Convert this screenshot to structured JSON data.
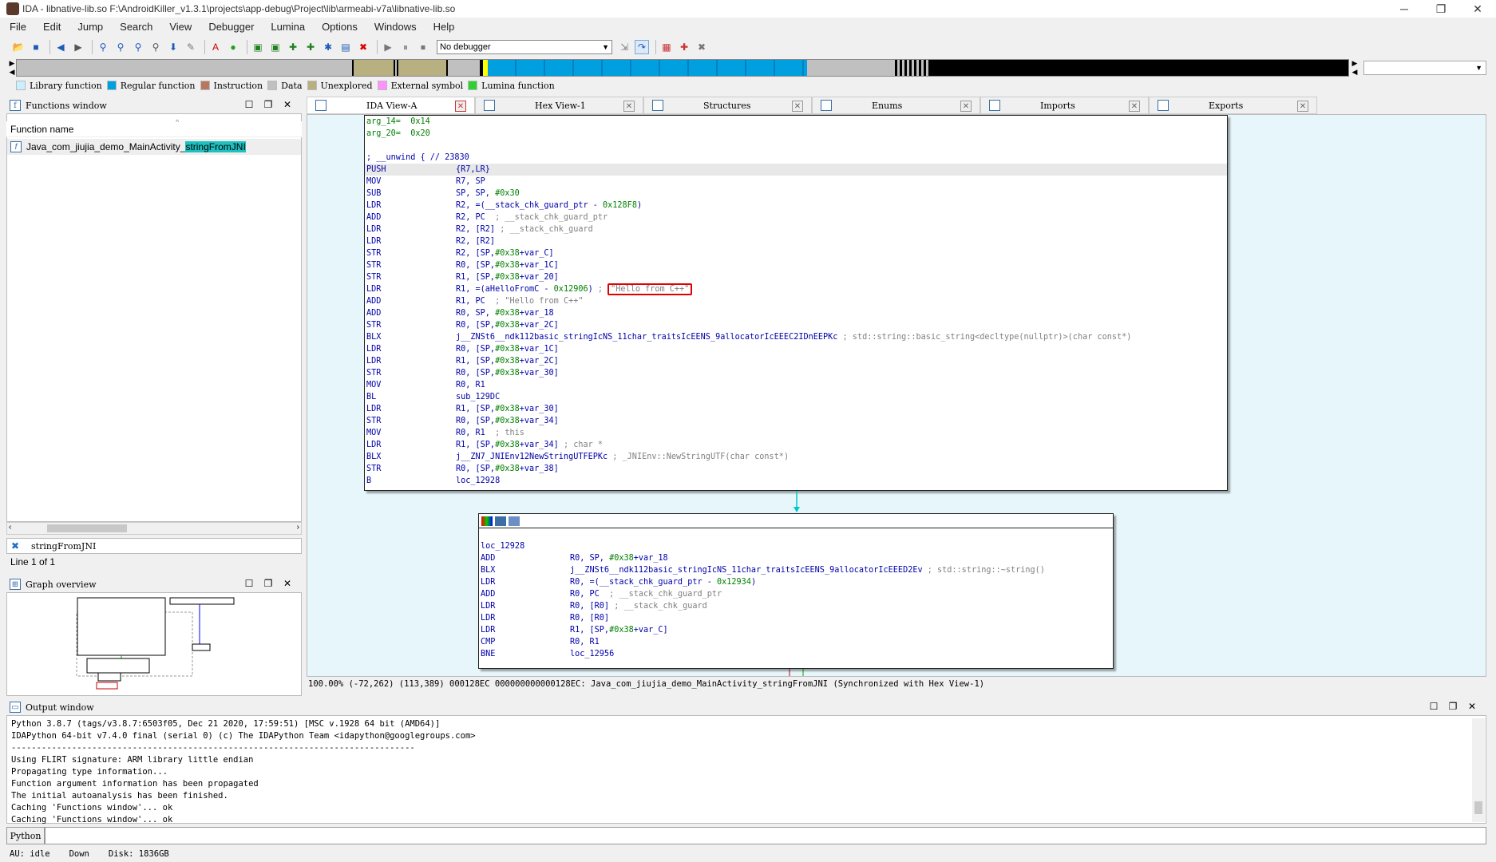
{
  "window": {
    "title": "IDA - libnative-lib.so F:\\AndroidKiller_v1.3.1\\projects\\app-debug\\Project\\lib\\armeabi-v7a\\libnative-lib.so",
    "min": "─",
    "max": "❐",
    "close": "✕"
  },
  "menu": [
    "File",
    "Edit",
    "Jump",
    "Search",
    "View",
    "Debugger",
    "Lumina",
    "Options",
    "Windows",
    "Help"
  ],
  "toolbar": {
    "debugger": "No debugger"
  },
  "legend": [
    {
      "label": "Library function",
      "color": "#c8f0ff"
    },
    {
      "label": "Regular function",
      "color": "#00a0e0"
    },
    {
      "label": "Instruction",
      "color": "#b87860"
    },
    {
      "label": "Data",
      "color": "#c0c0c0"
    },
    {
      "label": "Unexplored",
      "color": "#b8b080"
    },
    {
      "label": "External symbol",
      "color": "#ff90ff"
    },
    {
      "label": "Lumina function",
      "color": "#30d030"
    }
  ],
  "functions_window": {
    "title": "Functions window",
    "column": "Function name",
    "row_prefix": "Java_com_jiujia_demo_MainActivity_",
    "row_highlight": "stringFromJNI",
    "search": "stringFromJNI",
    "line_count": "Line 1 of 1"
  },
  "graph_overview": {
    "title": "Graph overview"
  },
  "tabs": [
    {
      "label": "IDA View-A",
      "active": true
    },
    {
      "label": "Hex View-1",
      "active": false
    },
    {
      "label": "Structures",
      "active": false
    },
    {
      "label": "Enums",
      "active": false
    },
    {
      "label": "Imports",
      "active": false
    },
    {
      "label": "Exports",
      "active": false
    }
  ],
  "node1": {
    "lines": [
      {
        "t": "arg",
        "a": "arg_14=  ",
        "b": "0x14"
      },
      {
        "t": "arg",
        "a": "arg_20=  ",
        "b": "0x20"
      },
      {
        "t": "blank"
      },
      {
        "t": "comment",
        "text": "; __unwind { // 23830"
      },
      {
        "t": "ins",
        "m": "PUSH",
        "o": "{R7,LR}",
        "c": "",
        "sel": true
      },
      {
        "t": "ins",
        "m": "MOV",
        "o": "R7, SP",
        "c": ""
      },
      {
        "t": "ins",
        "m": "SUB",
        "o": "SP, SP, #0x30",
        "c": ""
      },
      {
        "t": "ins",
        "m": "LDR",
        "o": "R2, =(__stack_chk_guard_ptr - 0x128F8)",
        "c": ""
      },
      {
        "t": "ins",
        "m": "ADD",
        "o": "R2, PC",
        "c": "  ; __stack_chk_guard_ptr"
      },
      {
        "t": "ins",
        "m": "LDR",
        "o": "R2, [R2]",
        "c": " ; __stack_chk_guard"
      },
      {
        "t": "ins",
        "m": "LDR",
        "o": "R2, [R2]",
        "c": ""
      },
      {
        "t": "ins",
        "m": "STR",
        "o": "R2, [SP,#0x38+var_C]",
        "c": ""
      },
      {
        "t": "ins",
        "m": "STR",
        "o": "R0, [SP,#0x38+var_1C]",
        "c": ""
      },
      {
        "t": "ins",
        "m": "STR",
        "o": "R1, [SP,#0x38+var_20]",
        "c": ""
      },
      {
        "t": "ins",
        "m": "LDR",
        "o": "R1, =(aHelloFromC - 0x12906)",
        "c": " ; ",
        "box": "\"Hello from C++\""
      },
      {
        "t": "ins",
        "m": "ADD",
        "o": "R1, PC",
        "c": "  ; \"Hello from C++\""
      },
      {
        "t": "ins",
        "m": "ADD",
        "o": "R0, SP, #0x38+var_18",
        "c": ""
      },
      {
        "t": "ins",
        "m": "STR",
        "o": "R0, [SP,#0x38+var_2C]",
        "c": ""
      },
      {
        "t": "ins",
        "m": "BLX",
        "o": "j__ZNSt6__ndk112basic_stringIcNS_11char_traitsIcEENS_9allocatorIcEEEC2IDnEEPKc",
        "c": " ; std::string::basic_string<decltype(nullptr)>(char const*)"
      },
      {
        "t": "ins",
        "m": "LDR",
        "o": "R0, [SP,#0x38+var_1C]",
        "c": ""
      },
      {
        "t": "ins",
        "m": "LDR",
        "o": "R1, [SP,#0x38+var_2C]",
        "c": ""
      },
      {
        "t": "ins",
        "m": "STR",
        "o": "R0, [SP,#0x38+var_30]",
        "c": ""
      },
      {
        "t": "ins",
        "m": "MOV",
        "o": "R0, R1",
        "c": ""
      },
      {
        "t": "ins",
        "m": "BL",
        "o": "sub_129DC",
        "c": ""
      },
      {
        "t": "ins",
        "m": "LDR",
        "o": "R1, [SP,#0x38+var_30]",
        "c": ""
      },
      {
        "t": "ins",
        "m": "STR",
        "o": "R0, [SP,#0x38+var_34]",
        "c": ""
      },
      {
        "t": "ins",
        "m": "MOV",
        "o": "R0, R1",
        "c": "  ; this"
      },
      {
        "t": "ins",
        "m": "LDR",
        "o": "R1, [SP,#0x38+var_34]",
        "c": " ; char *"
      },
      {
        "t": "ins",
        "m": "BLX",
        "o": "j__ZN7_JNIEnv12NewStringUTFEPKc",
        "c": " ; _JNIEnv::NewStringUTF(char const*)"
      },
      {
        "t": "ins",
        "m": "STR",
        "o": "R0, [SP,#0x38+var_38]",
        "c": ""
      },
      {
        "t": "ins",
        "m": "B",
        "o": "loc_12928",
        "c": ""
      }
    ]
  },
  "node2": {
    "lines": [
      {
        "t": "blank"
      },
      {
        "t": "label",
        "text": "loc_12928"
      },
      {
        "t": "ins",
        "m": "ADD",
        "o": "R0, SP, #0x38+var_18",
        "c": ""
      },
      {
        "t": "ins",
        "m": "BLX",
        "o": "j__ZNSt6__ndk112basic_stringIcNS_11char_traitsIcEENS_9allocatorIcEEED2Ev",
        "c": " ; std::string::~string()"
      },
      {
        "t": "ins",
        "m": "LDR",
        "o": "R0, =(__stack_chk_guard_ptr - 0x12934)",
        "c": ""
      },
      {
        "t": "ins",
        "m": "ADD",
        "o": "R0, PC",
        "c": "  ; __stack_chk_guard_ptr"
      },
      {
        "t": "ins",
        "m": "LDR",
        "o": "R0, [R0]",
        "c": " ; __stack_chk_guard"
      },
      {
        "t": "ins",
        "m": "LDR",
        "o": "R0, [R0]",
        "c": ""
      },
      {
        "t": "ins",
        "m": "LDR",
        "o": "R1, [SP,#0x38+var_C]",
        "c": ""
      },
      {
        "t": "ins",
        "m": "CMP",
        "o": "R0, R1",
        "c": ""
      },
      {
        "t": "ins",
        "m": "BNE",
        "o": "loc_12956",
        "c": ""
      }
    ]
  },
  "status_line": "100.00% (-72,262) (113,389) 000128EC 000000000000128EC: Java_com_jiujia_demo_MainActivity_stringFromJNI (Synchronized with Hex View-1)",
  "output": {
    "title": "Output window",
    "lines": [
      "Python 3.8.7 (tags/v3.8.7:6503f05, Dec 21 2020, 17:59:51) [MSC v.1928 64 bit (AMD64)]",
      "IDAPython 64-bit v7.4.0 final (serial 0) (c) The IDAPython Team <idapython@googlegroups.com>",
      "--------------------------------------------------------------------------------",
      "Using FLIRT signature: ARM library little endian",
      "Propagating type information...",
      "Function argument information has been propagated",
      "The initial autoanalysis has been finished.",
      "Caching 'Functions window'... ok",
      "Caching 'Functions window'... ok"
    ],
    "python_button": "Python"
  },
  "statusbar": {
    "au": "AU:  idle",
    "dir": "Down",
    "disk": "Disk: 1836GB"
  }
}
